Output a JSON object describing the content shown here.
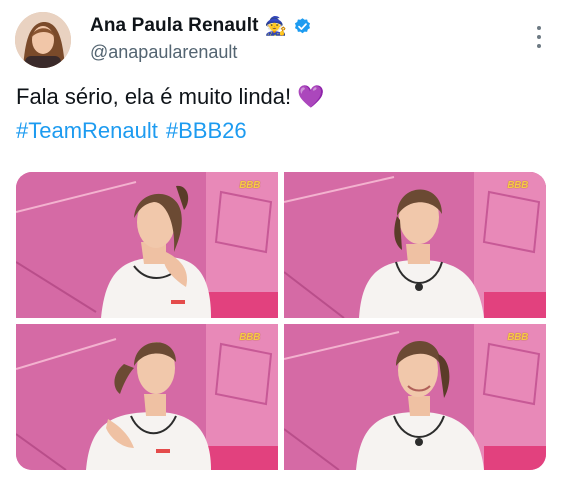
{
  "tweet": {
    "author": {
      "display_name": "Ana Paula Renault",
      "badge_emoji": "🧙",
      "handle": "@anapaularenault",
      "verified": true,
      "avatar_icon": "profile-photo"
    },
    "text_line1": "Fala sério, ela é muito linda!",
    "text_line1_emoji": "💜",
    "hashtags": [
      "#TeamRenault",
      "#BBB26"
    ],
    "media": {
      "count": 4,
      "watermark": "BBB"
    }
  },
  "colors": {
    "link": "#1d9bf0",
    "verified": "#1d9bf0",
    "secondary_text": "#536471",
    "room_pink": "#d86aa6"
  }
}
